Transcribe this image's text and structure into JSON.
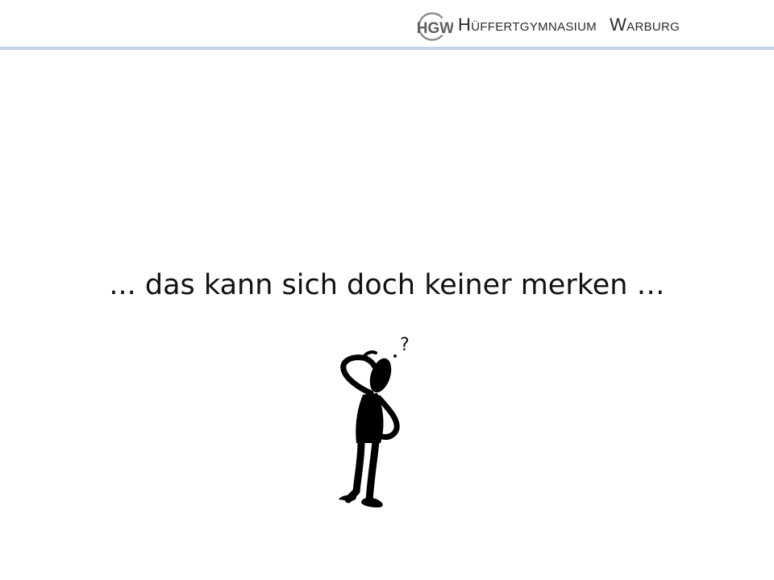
{
  "header": {
    "school_name_part1": "Hüffertgymnasium",
    "school_name_part2": "Warburg",
    "logo_text": "HGW",
    "rule_color": "#c5d1ef"
  },
  "slide": {
    "main_text": "... das kann sich doch keiner merken …"
  },
  "illustration": {
    "icon": "confused-thinker-icon",
    "symbol": "?"
  }
}
